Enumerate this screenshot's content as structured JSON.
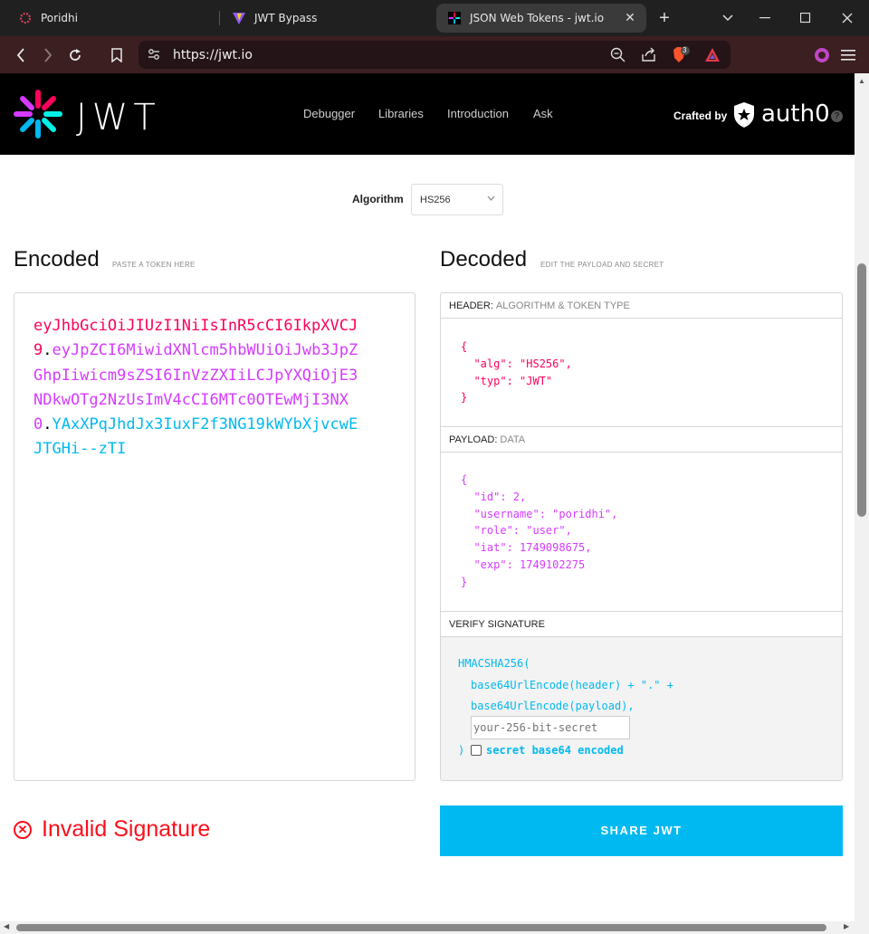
{
  "browser": {
    "tabs": [
      {
        "title": "Poridhi"
      },
      {
        "title": "JWT Bypass"
      },
      {
        "title": "JSON Web Tokens - jwt.io"
      }
    ],
    "url": "https://jwt.io",
    "brave_badge": "3"
  },
  "site": {
    "logo_text": "JWT",
    "nav": [
      "Debugger",
      "Libraries",
      "Introduction",
      "Ask"
    ],
    "crafted_by": "Crafted by",
    "auth0": "auth0",
    "help": "?"
  },
  "algorithm": {
    "label": "Algorithm",
    "value": "HS256"
  },
  "encoded": {
    "title": "Encoded",
    "subtitle": "PASTE A TOKEN HERE",
    "header_part": "eyJhbGciOiJIUzI1NiIsInR5cCI6IkpXVCJ9",
    "payload_part": "eyJpZCI6MiwidXNlcm5hbWUiOiJwb3JpZGhpIiwicm9sZSI6InVzZXIiLCJpYXQiOjE3NDkwOTg2NzUsImV4cCI6MTc0OTEwMjI3NX0",
    "signature_part": "YAxXPqJhdJx3IuxF2f3NG19kWYbXjvcwEJTGHi--zTI",
    "dot": "."
  },
  "decoded": {
    "title": "Decoded",
    "subtitle": "EDIT THE PAYLOAD AND SECRET",
    "header_label": "HEADER:",
    "header_sub": "ALGORITHM & TOKEN TYPE",
    "header_json": "{\n  \"alg\": \"HS256\",\n  \"typ\": \"JWT\"\n}",
    "payload_label": "PAYLOAD:",
    "payload_sub": "DATA",
    "payload_json": "{\n  \"id\": 2,\n  \"username\": \"poridhi\",\n  \"role\": \"user\",\n  \"iat\": 1749098675,\n  \"exp\": 1749102275\n}",
    "verify_label": "VERIFY SIGNATURE",
    "sig_line1": "HMACSHA256(",
    "sig_line2": "base64UrlEncode(header) + \".\" +",
    "sig_line3": "base64UrlEncode(payload),",
    "secret_placeholder": "your-256-bit-secret",
    "sig_close": ")",
    "base64_label": "secret base64 encoded"
  },
  "status": {
    "invalid": "Invalid Signature"
  },
  "share_button": "SHARE JWT",
  "colors": {
    "header": "#fb015b",
    "payload": "#d63aff",
    "signature": "#00b9f1",
    "error": "#fb0f1b",
    "chrome_nav": "#3b1f21"
  }
}
